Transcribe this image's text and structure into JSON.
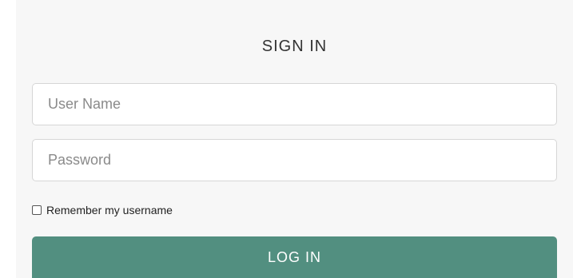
{
  "form": {
    "title": "SIGN IN",
    "username": {
      "value": "",
      "placeholder": "User Name"
    },
    "password": {
      "value": "",
      "placeholder": "Password"
    },
    "remember": {
      "label": "Remember my username",
      "checked": false
    },
    "login_label": "LOG IN"
  },
  "colors": {
    "panel_background": "#f7f7f7",
    "button_background": "#528f80",
    "button_text": "#ffffff"
  }
}
